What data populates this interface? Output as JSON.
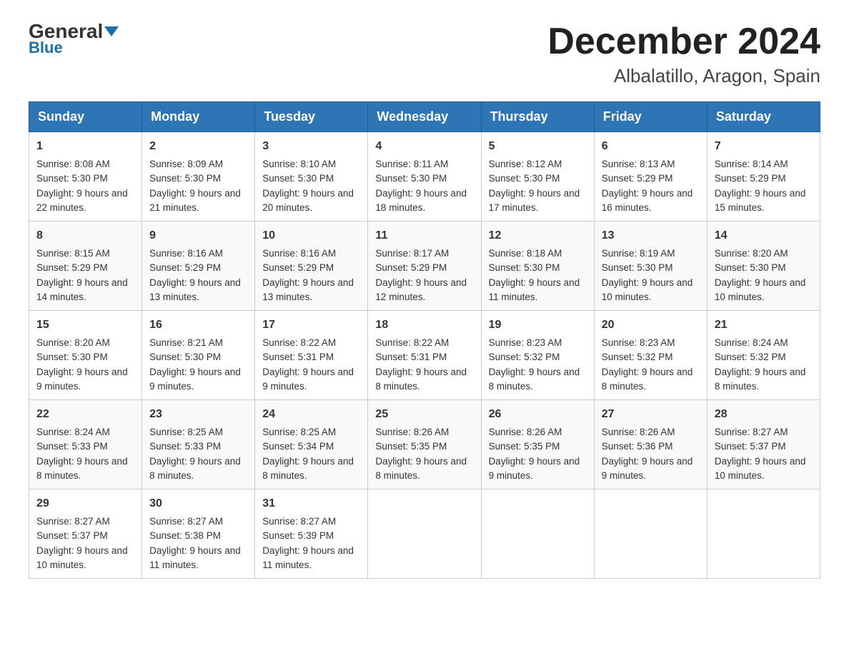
{
  "header": {
    "logo_general": "General",
    "logo_blue": "Blue",
    "month_title": "December 2024",
    "location": "Albalatillo, Aragon, Spain"
  },
  "days_of_week": [
    "Sunday",
    "Monday",
    "Tuesday",
    "Wednesday",
    "Thursday",
    "Friday",
    "Saturday"
  ],
  "weeks": [
    [
      {
        "day": "1",
        "sunrise": "8:08 AM",
        "sunset": "5:30 PM",
        "daylight": "9 hours and 22 minutes."
      },
      {
        "day": "2",
        "sunrise": "8:09 AM",
        "sunset": "5:30 PM",
        "daylight": "9 hours and 21 minutes."
      },
      {
        "day": "3",
        "sunrise": "8:10 AM",
        "sunset": "5:30 PM",
        "daylight": "9 hours and 20 minutes."
      },
      {
        "day": "4",
        "sunrise": "8:11 AM",
        "sunset": "5:30 PM",
        "daylight": "9 hours and 18 minutes."
      },
      {
        "day": "5",
        "sunrise": "8:12 AM",
        "sunset": "5:30 PM",
        "daylight": "9 hours and 17 minutes."
      },
      {
        "day": "6",
        "sunrise": "8:13 AM",
        "sunset": "5:29 PM",
        "daylight": "9 hours and 16 minutes."
      },
      {
        "day": "7",
        "sunrise": "8:14 AM",
        "sunset": "5:29 PM",
        "daylight": "9 hours and 15 minutes."
      }
    ],
    [
      {
        "day": "8",
        "sunrise": "8:15 AM",
        "sunset": "5:29 PM",
        "daylight": "9 hours and 14 minutes."
      },
      {
        "day": "9",
        "sunrise": "8:16 AM",
        "sunset": "5:29 PM",
        "daylight": "9 hours and 13 minutes."
      },
      {
        "day": "10",
        "sunrise": "8:16 AM",
        "sunset": "5:29 PM",
        "daylight": "9 hours and 13 minutes."
      },
      {
        "day": "11",
        "sunrise": "8:17 AM",
        "sunset": "5:29 PM",
        "daylight": "9 hours and 12 minutes."
      },
      {
        "day": "12",
        "sunrise": "8:18 AM",
        "sunset": "5:30 PM",
        "daylight": "9 hours and 11 minutes."
      },
      {
        "day": "13",
        "sunrise": "8:19 AM",
        "sunset": "5:30 PM",
        "daylight": "9 hours and 10 minutes."
      },
      {
        "day": "14",
        "sunrise": "8:20 AM",
        "sunset": "5:30 PM",
        "daylight": "9 hours and 10 minutes."
      }
    ],
    [
      {
        "day": "15",
        "sunrise": "8:20 AM",
        "sunset": "5:30 PM",
        "daylight": "9 hours and 9 minutes."
      },
      {
        "day": "16",
        "sunrise": "8:21 AM",
        "sunset": "5:30 PM",
        "daylight": "9 hours and 9 minutes."
      },
      {
        "day": "17",
        "sunrise": "8:22 AM",
        "sunset": "5:31 PM",
        "daylight": "9 hours and 9 minutes."
      },
      {
        "day": "18",
        "sunrise": "8:22 AM",
        "sunset": "5:31 PM",
        "daylight": "9 hours and 8 minutes."
      },
      {
        "day": "19",
        "sunrise": "8:23 AM",
        "sunset": "5:32 PM",
        "daylight": "9 hours and 8 minutes."
      },
      {
        "day": "20",
        "sunrise": "8:23 AM",
        "sunset": "5:32 PM",
        "daylight": "9 hours and 8 minutes."
      },
      {
        "day": "21",
        "sunrise": "8:24 AM",
        "sunset": "5:32 PM",
        "daylight": "9 hours and 8 minutes."
      }
    ],
    [
      {
        "day": "22",
        "sunrise": "8:24 AM",
        "sunset": "5:33 PM",
        "daylight": "9 hours and 8 minutes."
      },
      {
        "day": "23",
        "sunrise": "8:25 AM",
        "sunset": "5:33 PM",
        "daylight": "9 hours and 8 minutes."
      },
      {
        "day": "24",
        "sunrise": "8:25 AM",
        "sunset": "5:34 PM",
        "daylight": "9 hours and 8 minutes."
      },
      {
        "day": "25",
        "sunrise": "8:26 AM",
        "sunset": "5:35 PM",
        "daylight": "9 hours and 8 minutes."
      },
      {
        "day": "26",
        "sunrise": "8:26 AM",
        "sunset": "5:35 PM",
        "daylight": "9 hours and 9 minutes."
      },
      {
        "day": "27",
        "sunrise": "8:26 AM",
        "sunset": "5:36 PM",
        "daylight": "9 hours and 9 minutes."
      },
      {
        "day": "28",
        "sunrise": "8:27 AM",
        "sunset": "5:37 PM",
        "daylight": "9 hours and 10 minutes."
      }
    ],
    [
      {
        "day": "29",
        "sunrise": "8:27 AM",
        "sunset": "5:37 PM",
        "daylight": "9 hours and 10 minutes."
      },
      {
        "day": "30",
        "sunrise": "8:27 AM",
        "sunset": "5:38 PM",
        "daylight": "9 hours and 11 minutes."
      },
      {
        "day": "31",
        "sunrise": "8:27 AM",
        "sunset": "5:39 PM",
        "daylight": "9 hours and 11 minutes."
      },
      null,
      null,
      null,
      null
    ]
  ]
}
